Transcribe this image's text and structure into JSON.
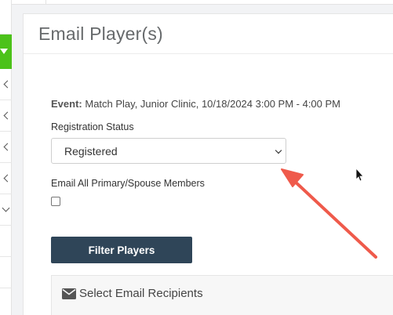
{
  "card": {
    "title": "Email Player(s)"
  },
  "event": {
    "label": "Event:",
    "value": "Match Play, Junior Clinic, 10/18/2024 3:00 PM - 4:00 PM"
  },
  "registration_status": {
    "label": "Registration Status",
    "selected": "Registered"
  },
  "email_all": {
    "label": "Email All Primary/Spouse Members",
    "checked": false
  },
  "filter_button": {
    "label": "Filter Players"
  },
  "recipients": {
    "title": "Select Email Recipients",
    "icon": "envelope-icon"
  },
  "colors": {
    "accent_green": "#4cc21a",
    "button_navy": "#2f4558",
    "annotation_arrow": "#ef5a4b"
  },
  "sidebar": {
    "icons": [
      "chevron-left-icon",
      "chevron-left-icon",
      "chevron-left-icon",
      "chevron-left-icon",
      "chevron-down-icon"
    ]
  }
}
